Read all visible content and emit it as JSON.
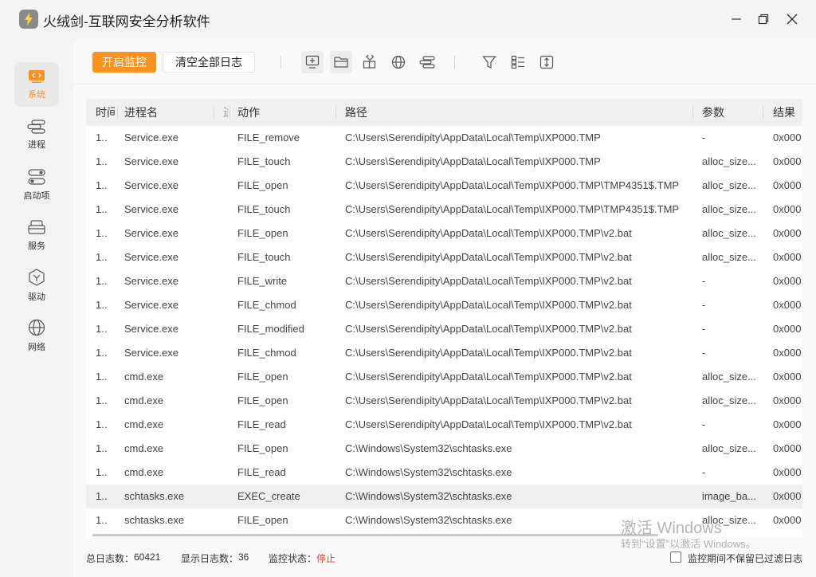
{
  "window": {
    "title": "火绒剑-互联网安全分析软件"
  },
  "sidebar": {
    "items": [
      {
        "label": "系统",
        "icon": "system-icon",
        "active": true
      },
      {
        "label": "进程",
        "icon": "process-icon",
        "active": false
      },
      {
        "label": "启动项",
        "icon": "startup-icon",
        "active": false
      },
      {
        "label": "服务",
        "icon": "service-icon",
        "active": false
      },
      {
        "label": "驱动",
        "icon": "driver-icon",
        "active": false
      },
      {
        "label": "网络",
        "icon": "network-icon",
        "active": false
      }
    ]
  },
  "toolbar": {
    "start_label": "开启监控",
    "clear_label": "清空全部日志",
    "icons": [
      "monitor-icon",
      "folder-icon",
      "registry-icon",
      "network-icon",
      "process-icon",
      "filter-icon",
      "columns-icon",
      "expand-icon"
    ]
  },
  "table": {
    "columns": [
      "时间",
      "进程名",
      "进",
      "动作",
      "路径",
      "参数",
      "结果"
    ],
    "rows": [
      {
        "time": "1..",
        "process": "Service.exe",
        "action": "FILE_remove",
        "path": "C:\\Users\\Serendipity\\AppData\\Local\\Temp\\IXP000.TMP",
        "param": "-",
        "result": "0x000"
      },
      {
        "time": "1..",
        "process": "Service.exe",
        "action": "FILE_touch",
        "path": "C:\\Users\\Serendipity\\AppData\\Local\\Temp\\IXP000.TMP",
        "param": "alloc_size...",
        "result": "0x000"
      },
      {
        "time": "1..",
        "process": "Service.exe",
        "action": "FILE_open",
        "path": "C:\\Users\\Serendipity\\AppData\\Local\\Temp\\IXP000.TMP\\TMP4351$.TMP",
        "param": "alloc_size...",
        "result": "0x000"
      },
      {
        "time": "1..",
        "process": "Service.exe",
        "action": "FILE_touch",
        "path": "C:\\Users\\Serendipity\\AppData\\Local\\Temp\\IXP000.TMP\\TMP4351$.TMP",
        "param": "alloc_size...",
        "result": "0x000"
      },
      {
        "time": "1..",
        "process": "Service.exe",
        "action": "FILE_open",
        "path": "C:\\Users\\Serendipity\\AppData\\Local\\Temp\\IXP000.TMP\\v2.bat",
        "param": "alloc_size...",
        "result": "0x000"
      },
      {
        "time": "1..",
        "process": "Service.exe",
        "action": "FILE_touch",
        "path": "C:\\Users\\Serendipity\\AppData\\Local\\Temp\\IXP000.TMP\\v2.bat",
        "param": "alloc_size...",
        "result": "0x000"
      },
      {
        "time": "1..",
        "process": "Service.exe",
        "action": "FILE_write",
        "path": "C:\\Users\\Serendipity\\AppData\\Local\\Temp\\IXP000.TMP\\v2.bat",
        "param": "-",
        "result": "0x000"
      },
      {
        "time": "1..",
        "process": "Service.exe",
        "action": "FILE_chmod",
        "path": "C:\\Users\\Serendipity\\AppData\\Local\\Temp\\IXP000.TMP\\v2.bat",
        "param": "-",
        "result": "0x000"
      },
      {
        "time": "1..",
        "process": "Service.exe",
        "action": "FILE_modified",
        "path": "C:\\Users\\Serendipity\\AppData\\Local\\Temp\\IXP000.TMP\\v2.bat",
        "param": "-",
        "result": "0x000"
      },
      {
        "time": "1..",
        "process": "Service.exe",
        "action": "FILE_chmod",
        "path": "C:\\Users\\Serendipity\\AppData\\Local\\Temp\\IXP000.TMP\\v2.bat",
        "param": "-",
        "result": "0x000"
      },
      {
        "time": "1..",
        "process": "cmd.exe",
        "action": "FILE_open",
        "path": "C:\\Users\\Serendipity\\AppData\\Local\\Temp\\IXP000.TMP\\v2.bat",
        "param": "alloc_size...",
        "result": "0x000"
      },
      {
        "time": "1..",
        "process": "cmd.exe",
        "action": "FILE_open",
        "path": "C:\\Users\\Serendipity\\AppData\\Local\\Temp\\IXP000.TMP\\v2.bat",
        "param": "alloc_size...",
        "result": "0x000"
      },
      {
        "time": "1..",
        "process": "cmd.exe",
        "action": "FILE_read",
        "path": "C:\\Users\\Serendipity\\AppData\\Local\\Temp\\IXP000.TMP\\v2.bat",
        "param": "-",
        "result": "0x000"
      },
      {
        "time": "1..",
        "process": "cmd.exe",
        "action": "FILE_open",
        "path": "C:\\Windows\\System32\\schtasks.exe",
        "param": "alloc_size...",
        "result": "0x000"
      },
      {
        "time": "1..",
        "process": "cmd.exe",
        "action": "FILE_read",
        "path": "C:\\Windows\\System32\\schtasks.exe",
        "param": "-",
        "result": "0x000"
      },
      {
        "time": "1..",
        "process": "schtasks.exe",
        "action": "EXEC_create",
        "path": "C:\\Windows\\System32\\schtasks.exe",
        "param": "image_ba...",
        "result": "0x000",
        "selected": true
      },
      {
        "time": "1..",
        "process": "schtasks.exe",
        "action": "FILE_open",
        "path": "C:\\Windows\\System32\\schtasks.exe",
        "param": "alloc_size...",
        "result": "0x000"
      }
    ]
  },
  "status": {
    "total_label": "总日志数：",
    "total_value": "60421",
    "shown_label": "显示日志数：",
    "shown_value": "36",
    "monitor_label": "监控状态：",
    "monitor_value": "停止",
    "checkbox_label": "监控期间不保留已过滤日志"
  },
  "watermark": {
    "line1": "激活 Windows",
    "line2": "转到\"设置\"以激活 Windows。"
  },
  "colors": {
    "accent": "#f7931e",
    "stop": "#e0452b"
  }
}
